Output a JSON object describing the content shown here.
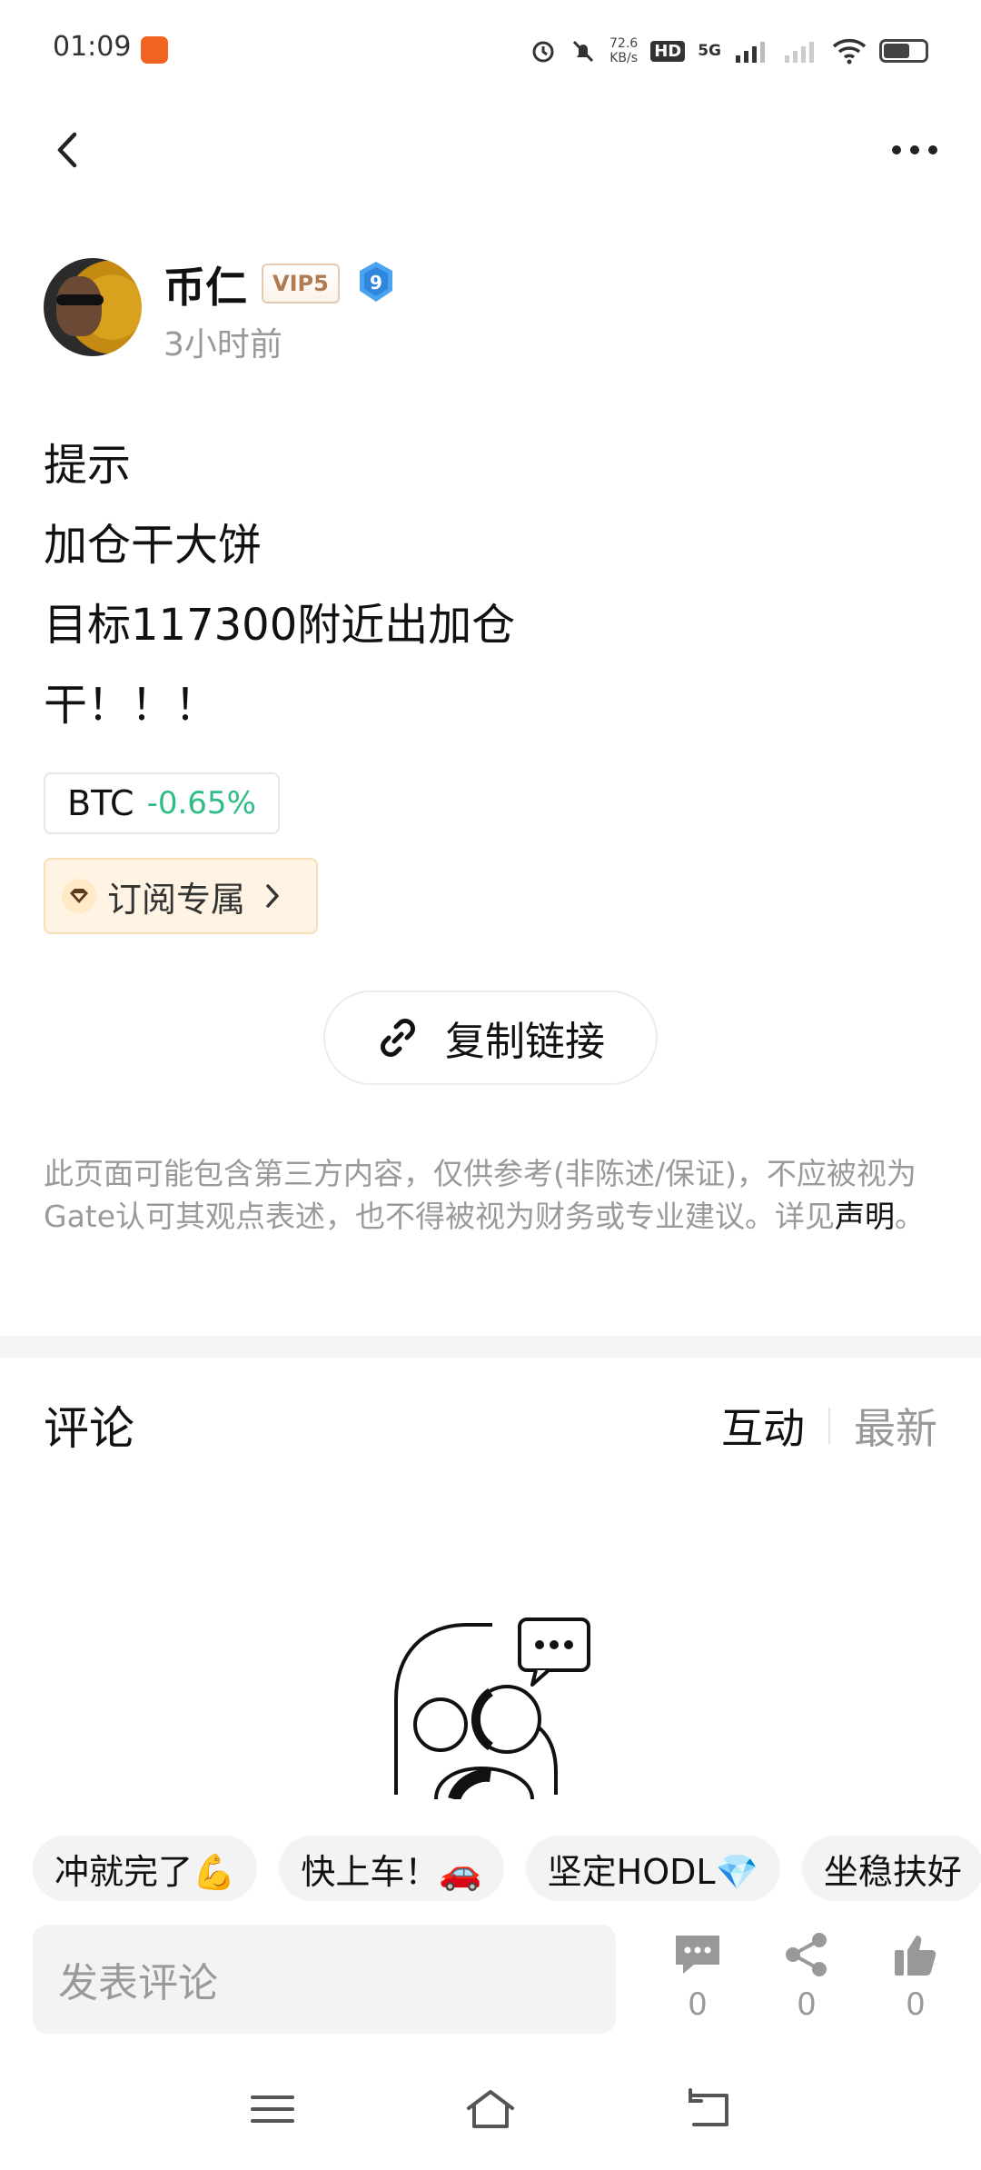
{
  "status_bar": {
    "time": "01:09",
    "net_speed_value": "72.6",
    "net_speed_unit": "KB/s",
    "hd_label": "HD",
    "hd_sub": "1",
    "network_type": "5G"
  },
  "author": {
    "name": "币仁",
    "vip_label": "VIP5",
    "level": "9",
    "time_ago": "3小时前"
  },
  "post": {
    "lines": [
      "提示",
      "加仓干大饼",
      "目标117300附近出加仓",
      "干！！！"
    ]
  },
  "ticker": {
    "symbol": "BTC",
    "change": "-0.65%",
    "change_color": "#2dbd85"
  },
  "subscribe": {
    "label": "订阅专属"
  },
  "copy_link": {
    "label": "复制链接"
  },
  "disclaimer": {
    "text": "此页面可能包含第三方内容，仅供参考(非陈述/保证)，不应被视为Gate认可其观点表述，也不得被视为财务或专业建议。详见",
    "link": "声明",
    "suffix": "。"
  },
  "comments": {
    "title": "评论",
    "tabs": [
      {
        "label": "互动",
        "active": true
      },
      {
        "label": "最新",
        "active": false
      }
    ]
  },
  "quick_replies": [
    "冲就完了💪",
    "快上车！🚗",
    "坚定HODL💎",
    "坐稳扶好"
  ],
  "bottom_bar": {
    "input_placeholder": "发表评论",
    "comment_count": "0",
    "share_count": "0",
    "like_count": "0"
  }
}
